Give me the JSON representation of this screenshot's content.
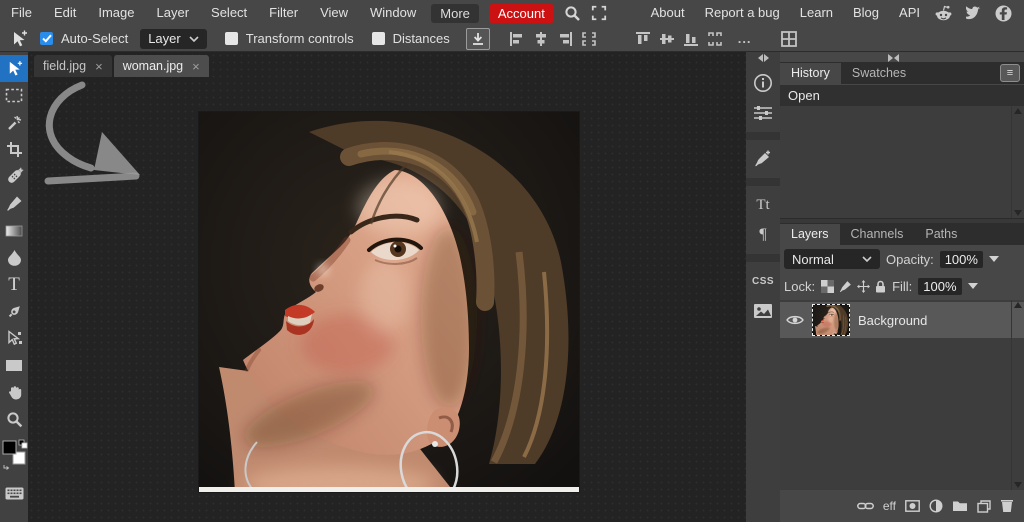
{
  "menubar": {
    "items": [
      "File",
      "Edit",
      "Image",
      "Layer",
      "Select",
      "Filter",
      "View",
      "Window"
    ],
    "more": "More",
    "account": "Account",
    "right_items": [
      "About",
      "Report a bug",
      "Learn",
      "Blog",
      "API"
    ],
    "social_icons": [
      "reddit-icon",
      "twitter-icon",
      "facebook-icon"
    ]
  },
  "options": {
    "auto_select": "Auto-Select",
    "auto_select_checked": true,
    "target_value": "Layer",
    "transform_controls": "Transform controls",
    "distances": "Distances",
    "ellipsis": "...",
    "icons": [
      "move-tool-icon",
      "open-place-icon",
      "align-left-icon",
      "align-center-h-icon",
      "align-right-icon",
      "distribute-h-icon",
      "align-top-icon",
      "align-middle-icon",
      "align-bottom-icon",
      "distribute-v-icon",
      "more-options",
      "arrange-windows-icon"
    ]
  },
  "document_tabs": [
    {
      "label": "field.jpg",
      "close": "×",
      "active": false
    },
    {
      "label": "woman.jpg",
      "close": "×",
      "active": true
    }
  ],
  "tools": [
    "move",
    "rectangle-select",
    "magic-wand",
    "crop",
    "spot-healing",
    "brush",
    "gradient",
    "blur",
    "type",
    "pen",
    "path-select",
    "rectangle-shape",
    "hand",
    "zoom"
  ],
  "tool_glyphs": {
    "type": "T"
  },
  "color_swatches": {
    "foreground": "#000000",
    "background": "#ffffff"
  },
  "side_strip": {
    "icons": [
      "info",
      "adjustments",
      "brush-settings",
      "character",
      "paragraph",
      "css",
      "image"
    ],
    "character_glyph": "Tt",
    "paragraph_glyph": "¶",
    "css_glyph": "CSS"
  },
  "history_panel": {
    "tabs": [
      "History",
      "Swatches"
    ],
    "menu_glyph": "≡",
    "items": [
      "Open"
    ]
  },
  "layers_panel": {
    "tabs": [
      "Layers",
      "Channels",
      "Paths"
    ],
    "menu_glyph": "≡",
    "blend_mode": "Normal",
    "opacity_label": "Opacity:",
    "opacity_value": "100%",
    "lock_label": "Lock:",
    "fill_label": "Fill:",
    "fill_value": "100%",
    "rows": [
      {
        "name": "Background",
        "visible": true,
        "selected": true
      }
    ],
    "bottom_icons": [
      "link",
      "effects",
      "mask",
      "adjustment",
      "group",
      "new-layer",
      "delete"
    ],
    "eff_label": "eff"
  },
  "colors": {
    "panel_bg": "#474747",
    "workspace_bg": "#232323",
    "accent_blue": "#2a8ceb",
    "selected_tool_blue": "#2272c3",
    "account_red": "#cb1111"
  }
}
